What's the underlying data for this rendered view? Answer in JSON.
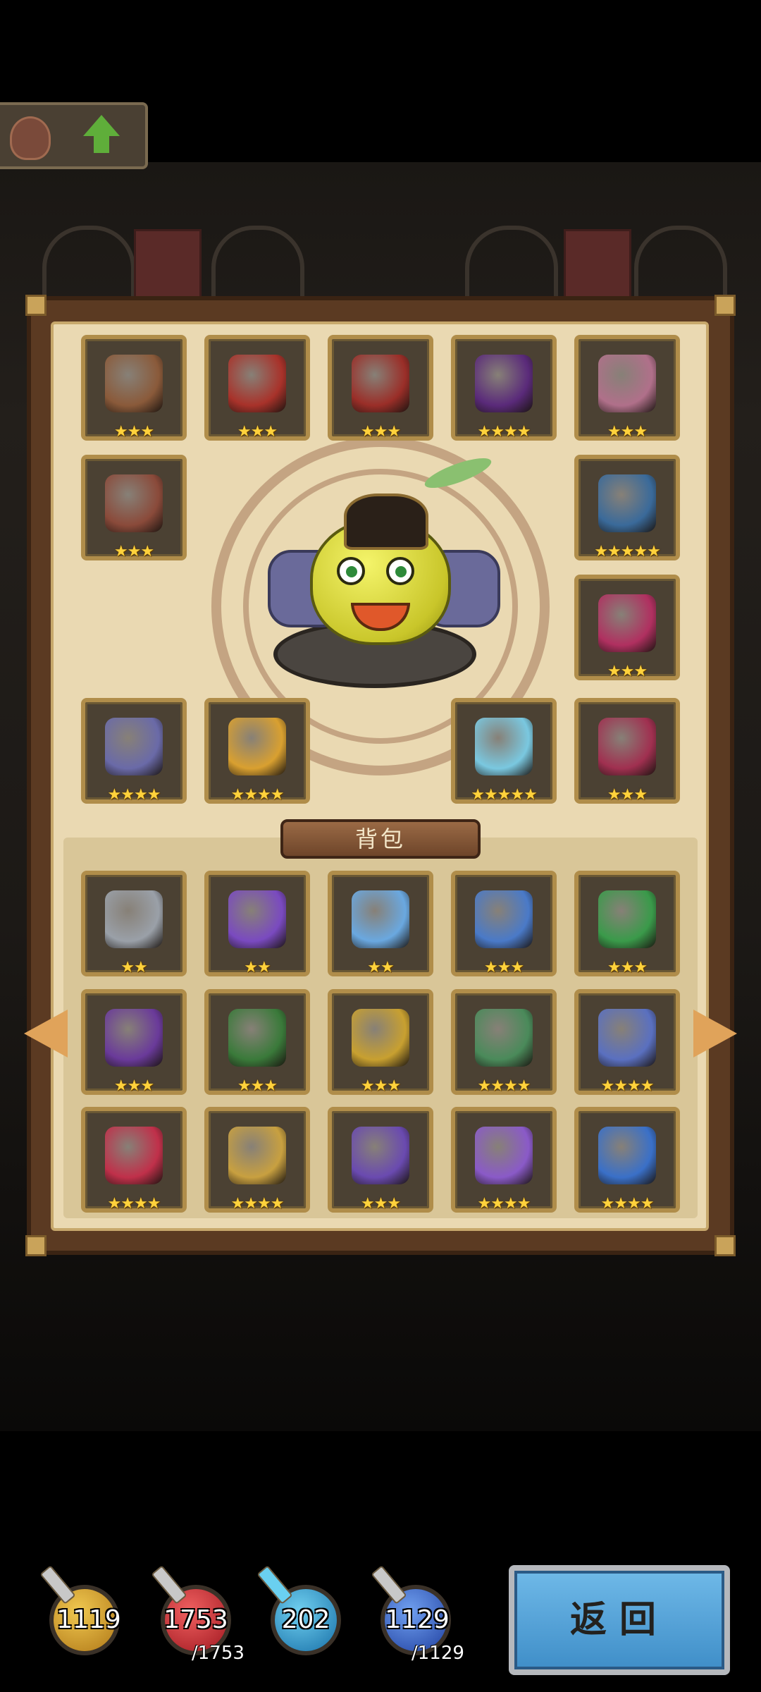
{
  "bag": {
    "label": "背包"
  },
  "colors": {
    "parchment": "#ead9b2",
    "frame": "#5b3a22",
    "slot_border": "#b08d4a",
    "star": "#ffd23c",
    "back_button": "#3f8ec8"
  },
  "equipped": [
    {
      "icon": "bracer-icon",
      "stars": "★★★",
      "color": "#8a5a3a"
    },
    {
      "icon": "chest-armor-icon",
      "stars": "★★★",
      "color": "#a8322a"
    },
    {
      "icon": "helmet-icon",
      "stars": "★★★",
      "color": "#9a2e28"
    },
    {
      "icon": "dark-lantern-icon",
      "stars": "★★★★",
      "color": "#5a2a7a"
    },
    {
      "icon": "amulet-icon",
      "stars": "★★★",
      "color": "#b0708a"
    },
    {
      "icon": "belt-icon",
      "stars": "★★★",
      "color": "#8a4a3a"
    },
    {
      "icon": "orb-gauntlet-icon",
      "stars": "★★★★★",
      "color": "#3a6a9a"
    },
    {
      "icon": "hood-icon",
      "stars": "★★★",
      "color": "#b03060"
    },
    {
      "icon": "harp-icon",
      "stars": "★★★★",
      "color": "#6a6aa8"
    },
    {
      "icon": "golden-tome-icon",
      "stars": "★★★★",
      "color": "#d9a030"
    },
    {
      "icon": "ice-book-icon",
      "stars": "★★★★★",
      "color": "#7ac8e0"
    },
    {
      "icon": "boots-icon",
      "stars": "★★★",
      "color": "#a03050"
    }
  ],
  "backpack": [
    {
      "icon": "silver-ring-icon",
      "stars": "★★",
      "color": "#9aa0a8"
    },
    {
      "icon": "purple-boots-icon",
      "stars": "★★",
      "color": "#7a4ac0"
    },
    {
      "icon": "ice-orb-icon",
      "stars": "★★",
      "color": "#6aa8e0"
    },
    {
      "icon": "crystal-helm-icon",
      "stars": "★★★",
      "color": "#4a7ac8"
    },
    {
      "icon": "green-armor-icon",
      "stars": "★★★",
      "color": "#3a9a4a"
    },
    {
      "icon": "purple-belt-icon",
      "stars": "★★★",
      "color": "#6a3a9a"
    },
    {
      "icon": "green-cloak-icon",
      "stars": "★★★",
      "color": "#3a7a3a"
    },
    {
      "icon": "tentacle-orb-icon",
      "stars": "★★★",
      "color": "#c8a030"
    },
    {
      "icon": "horned-helm-icon",
      "stars": "★★★★",
      "color": "#4a8a5a"
    },
    {
      "icon": "gem-necklace-icon",
      "stars": "★★★★",
      "color": "#5a70c0"
    },
    {
      "icon": "ruby-ring-icon",
      "stars": "★★★★",
      "color": "#c0304a"
    },
    {
      "icon": "gold-ring-icon",
      "stars": "★★★★",
      "color": "#c8a040"
    },
    {
      "icon": "purple-cape-icon",
      "stars": "★★★",
      "color": "#6a4ab0"
    },
    {
      "icon": "crystal-pendant-icon",
      "stars": "★★★★",
      "color": "#8a5ac8"
    },
    {
      "icon": "blue-harp-icon",
      "stars": "★★★★",
      "color": "#3a70c8"
    }
  ],
  "resources": {
    "gold": {
      "value": "1119"
    },
    "hp": {
      "value": "1753",
      "max": "/1753"
    },
    "gem": {
      "value": "202"
    },
    "mp": {
      "value": "1129",
      "max": "/1129"
    }
  },
  "buttons": {
    "back_label": "返回"
  }
}
